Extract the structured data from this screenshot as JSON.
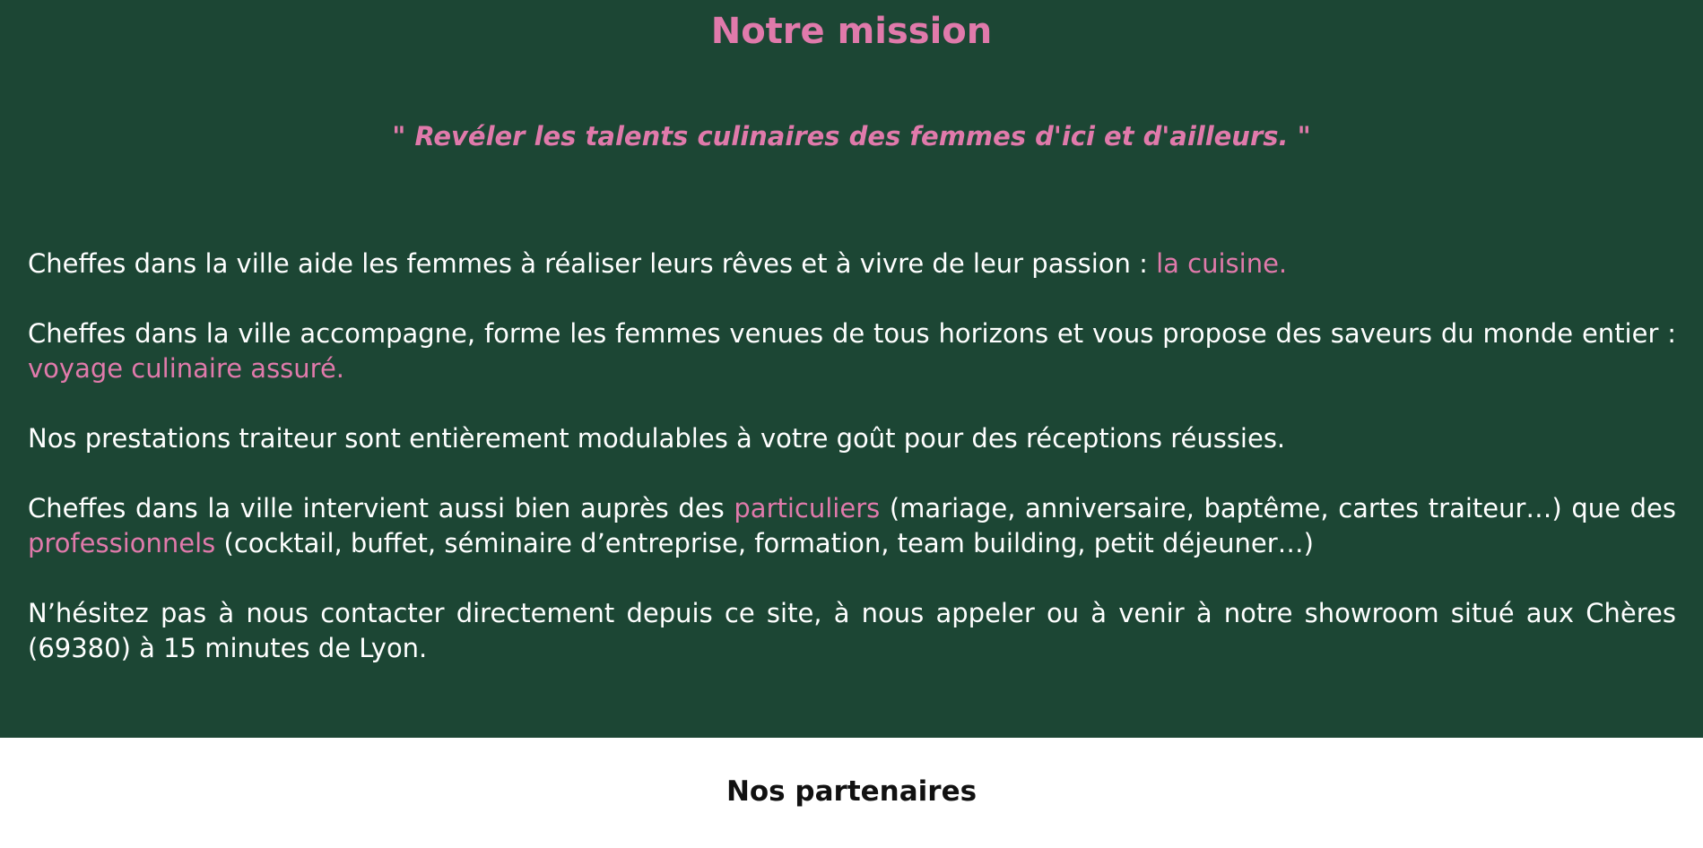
{
  "mission": {
    "title": "Notre mission",
    "quote": "\" Revéler les talents culinaires des femmes d'ici et d'ailleurs. \"",
    "p1": {
      "text": "Cheffes dans la ville aide les femmes à réaliser leurs rêves et à vivre de leur passion : ",
      "highlight": "la cuisine."
    },
    "p2": {
      "text": "Cheffes dans la ville accompagne, forme les femmes venues de tous horizons et vous propose des saveurs du monde entier : ",
      "highlight": "voyage culinaire assuré."
    },
    "p3": {
      "text": "Nos prestations traiteur sont entièrement modulables à votre goût pour des réceptions réussies."
    },
    "p4": {
      "text_before": "Cheffes dans la ville intervient aussi bien auprès des ",
      "highlight_1": "particuliers",
      "text_middle": " (mariage, anniversaire, baptême, cartes traiteur…) que des ",
      "highlight_2": "professionnels",
      "text_after": " (cocktail, buffet, séminaire d’entreprise, formation, team building, petit déjeuner…)"
    },
    "p5": {
      "text": "N’hésitez pas à nous contacter directement depuis ce site, à nous appeler ou à venir à notre showroom situé aux Chères (69380) à 15 minutes de Lyon."
    }
  },
  "partners": {
    "title": "Nos partenaires"
  },
  "colors": {
    "background_green": "#1c4634",
    "accent_pink": "#e07aab",
    "body_text": "#ffffff"
  }
}
